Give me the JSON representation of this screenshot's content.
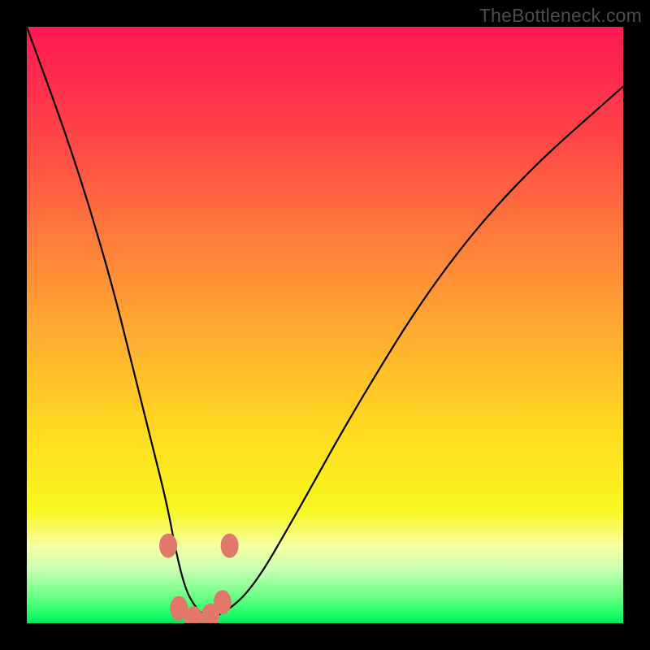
{
  "watermark": "TheBottleneck.com",
  "chart_data": {
    "type": "line",
    "title": "",
    "xlabel": "",
    "ylabel": "",
    "ylim": [
      0,
      100
    ],
    "xlim": [
      0,
      100
    ],
    "series": [
      {
        "name": "bottleneck-curve",
        "x": [
          0,
          8,
          14,
          18,
          21,
          23.5,
          25,
          26.5,
          28,
          30,
          33,
          38,
          45,
          55,
          68,
          82,
          100
        ],
        "values": [
          100,
          78,
          58,
          42,
          30,
          20,
          12,
          6,
          3,
          1,
          1.5,
          6,
          18,
          36,
          57,
          74,
          90
        ]
      }
    ],
    "markers": {
      "name": "highlight-points",
      "color": "#e2786c",
      "points": [
        {
          "x": 23.7,
          "y": 13
        },
        {
          "x": 34.0,
          "y": 13
        },
        {
          "x": 25.5,
          "y": 2.5
        },
        {
          "x": 28.0,
          "y": 0.8
        },
        {
          "x": 30.8,
          "y": 1.3
        },
        {
          "x": 32.8,
          "y": 3.5
        }
      ]
    },
    "gradient_stops": [
      {
        "pct": 0,
        "color": "#ff1a52"
      },
      {
        "pct": 50,
        "color": "#ffb030"
      },
      {
        "pct": 83,
        "color": "#f7f71e"
      },
      {
        "pct": 100,
        "color": "#00e85f"
      }
    ]
  }
}
